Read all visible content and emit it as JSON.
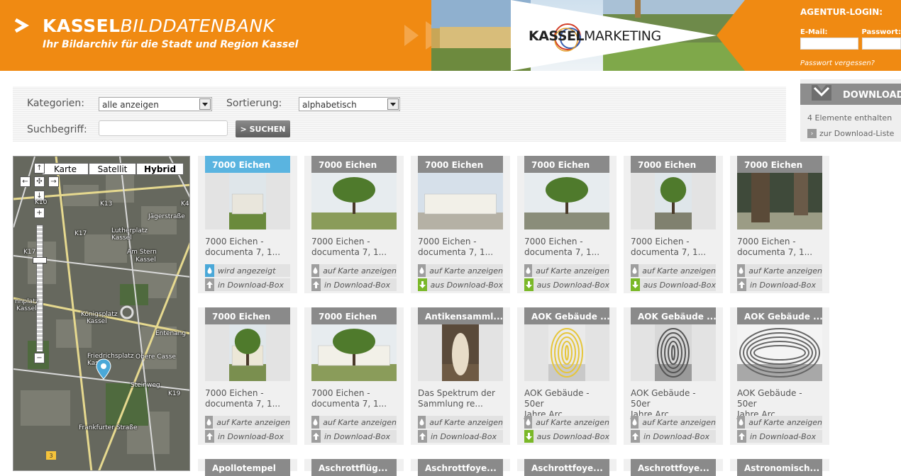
{
  "header": {
    "logo_bold": "KASSEL",
    "logo_light": "BILDDATENBANK",
    "subtitle": "Ihr Bildarchiv für die Stadt und Region Kassel",
    "banner_logo_bold": "KASSEL",
    "banner_logo_light": "MARKETING"
  },
  "login": {
    "title": "AGENTUR-LOGIN:",
    "email_label": "E-Mail:",
    "password_label": "Passwort:",
    "forgot": "Passwort vergessen?"
  },
  "filter": {
    "categories_label": "Kategorien:",
    "categories_value": "alle anzeigen",
    "sort_label": "Sortierung:",
    "sort_value": "alphabetisch",
    "search_label": "Suchbegriff:",
    "search_value": "",
    "search_button": "> SUCHEN"
  },
  "download_box": {
    "title": "DOWNLOAD-B",
    "count": "4 Elemente enthalten",
    "link": "zur Download-Liste"
  },
  "map": {
    "types": [
      "Karte",
      "Satellit",
      "Hybrid"
    ],
    "active_type": "Hybrid",
    "labels": [
      "Lutherplatz",
      "Kassel",
      "Am Stern",
      "Kassel",
      "Königsplatz",
      "Kassel",
      "Friedrichsplatz",
      "Kassel",
      "Jägerstraße",
      "Entenang",
      "Steinweg",
      "Frankfurter Straße",
      "Obere Casse",
      "K10",
      "K17",
      "K13",
      "K4",
      "K17",
      "K19",
      "Kassel",
      "nnplatz",
      "3"
    ]
  },
  "cards": [
    {
      "title": "7000 Eichen",
      "desc_line1": "7000 Eichen -",
      "desc_line2": "documenta 7, 1...",
      "action1": "wird angezeigt",
      "action2": "in Download-Box",
      "active": true,
      "in_box": false
    },
    {
      "title": "7000 Eichen",
      "desc_line1": "7000 Eichen -",
      "desc_line2": "documenta 7, 1...",
      "action1": "auf Karte anzeigen",
      "action2": "in Download-Box",
      "active": false,
      "in_box": false
    },
    {
      "title": "7000 Eichen",
      "desc_line1": "7000 Eichen -",
      "desc_line2": "documenta 7, 1...",
      "action1": "auf Karte anzeigen",
      "action2": "aus Download-Box",
      "active": false,
      "in_box": true
    },
    {
      "title": "7000 Eichen",
      "desc_line1": "7000 Eichen -",
      "desc_line2": "documenta 7, 1...",
      "action1": "auf Karte anzeigen",
      "action2": "aus Download-Box",
      "active": false,
      "in_box": true
    },
    {
      "title": "7000 Eichen",
      "desc_line1": "7000 Eichen -",
      "desc_line2": "documenta 7, 1...",
      "action1": "auf Karte anzeigen",
      "action2": "aus Download-Box",
      "active": false,
      "in_box": true
    },
    {
      "title": "7000 Eichen",
      "desc_line1": "7000 Eichen -",
      "desc_line2": "documenta 7, 1...",
      "action1": "auf Karte anzeigen",
      "action2": "in Download-Box",
      "active": false,
      "in_box": false
    },
    {
      "title": "7000 Eichen",
      "desc_line1": "7000 Eichen -",
      "desc_line2": "documenta 7, 1...",
      "action1": "auf Karte anzeigen",
      "action2": "in Download-Box",
      "active": false,
      "in_box": false
    },
    {
      "title": "7000 Eichen",
      "desc_line1": "7000 Eichen -",
      "desc_line2": "documenta 7, 1...",
      "action1": "auf Karte anzeigen",
      "action2": "in Download-Box",
      "active": false,
      "in_box": false
    },
    {
      "title": "Antikensamml...",
      "desc_line1": "Das Spektrum der",
      "desc_line2": "Sammlung re...",
      "action1": "auf Karte anzeigen",
      "action2": "in Download-Box",
      "active": false,
      "in_box": false
    },
    {
      "title": "AOK Gebäude ...",
      "desc_line1": "AOK Gebäude - 50er",
      "desc_line2": "Jahre Arc...",
      "action1": "auf Karte anzeigen",
      "action2": "aus Download-Box",
      "active": false,
      "in_box": true
    },
    {
      "title": "AOK Gebäude ...",
      "desc_line1": "AOK Gebäude - 50er",
      "desc_line2": "Jahre Arc...",
      "action1": "auf Karte anzeigen",
      "action2": "in Download-Box",
      "active": false,
      "in_box": false
    },
    {
      "title": "AOK Gebäude ...",
      "desc_line1": "AOK Gebäude - 50er",
      "desc_line2": "Jahre Arc...",
      "action1": "auf Karte anzeigen",
      "action2": "in Download-Box",
      "active": false,
      "in_box": false
    },
    {
      "title": "Apollotempel",
      "desc_line1": "",
      "desc_line2": "",
      "action1": "",
      "action2": "",
      "active": false,
      "in_box": false
    },
    {
      "title": "Aschrottflüg...",
      "desc_line1": "",
      "desc_line2": "",
      "action1": "",
      "action2": "",
      "active": false,
      "in_box": false
    },
    {
      "title": "Aschrottfoye...",
      "desc_line1": "",
      "desc_line2": "",
      "action1": "",
      "action2": "",
      "active": false,
      "in_box": false
    },
    {
      "title": "Aschrottfoye...",
      "desc_line1": "",
      "desc_line2": "",
      "action1": "",
      "action2": "",
      "active": false,
      "in_box": false
    },
    {
      "title": "Aschrottfoye...",
      "desc_line1": "",
      "desc_line2": "",
      "action1": "",
      "action2": "",
      "active": false,
      "in_box": false
    },
    {
      "title": "Astronomisch...",
      "desc_line1": "",
      "desc_line2": "",
      "action1": "",
      "action2": "",
      "active": false,
      "in_box": false
    }
  ],
  "colors": {
    "brand_orange": "#f08a12",
    "active_blue": "#5ab4e0",
    "header_gray": "#8a8a8a",
    "download_green": "#7ab828"
  }
}
